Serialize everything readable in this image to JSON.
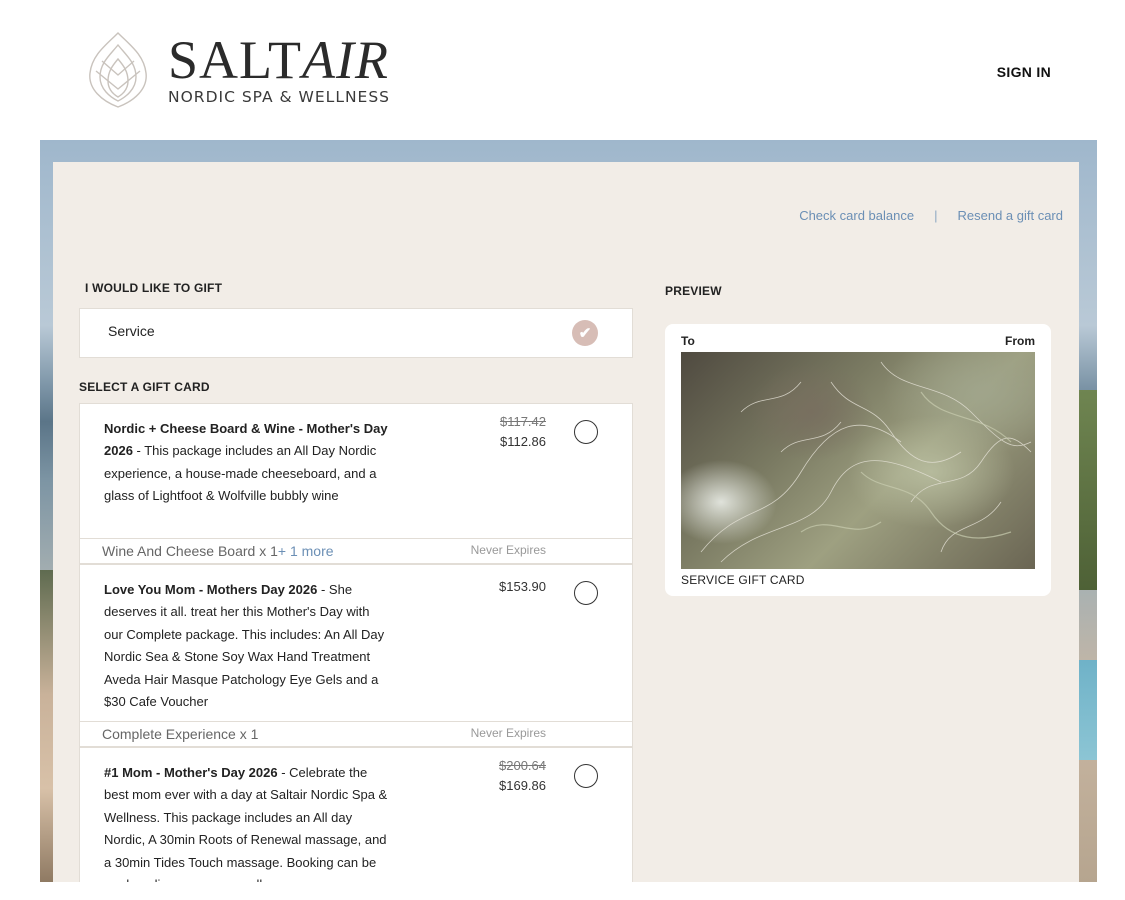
{
  "header": {
    "brand_name_a": "SALT",
    "brand_name_b": "AIR",
    "brand_tagline": "NORDIC SPA & WELLNESS",
    "sign_in": "SIGN IN"
  },
  "links": {
    "check_balance": "Check card balance",
    "separator": "|",
    "resend": "Resend a gift card"
  },
  "gift_type": {
    "label": "I WOULD LIKE TO GIFT",
    "selected": "Service",
    "check_icon": "check-icon"
  },
  "select_label": "SELECT A GIFT CARD",
  "cards": [
    {
      "title": "Nordic + Cheese Board & Wine - Mother's Day 2026",
      "description": " - This package includes an All Day Nordic experience, a house-made cheeseboard, and a glass of Lightfoot & Wolfville bubbly wine",
      "original_price": "$117.42",
      "price": "$112.86",
      "includes": "Wine And Cheese Board x 1",
      "more": "+ 1 more",
      "expiry": "Never Expires"
    },
    {
      "title": "Love You Mom - Mothers Day 2026",
      "description": " - She deserves it all. treat her this Mother's Day with our Complete package. This includes: An All Day Nordic Sea & Stone Soy Wax Hand Treatment Aveda Hair Masque Patchology Eye Gels and a $30 Cafe Voucher",
      "original_price": "",
      "price": "$153.90",
      "includes": "Complete Experience x 1",
      "more": "",
      "expiry": "Never Expires"
    },
    {
      "title": "#1 Mom - Mother's Day 2026",
      "description": " - Celebrate the best mom ever with a day at Saltair Nordic Spa & Wellness. This package includes an All day Nordic, A 30min Roots of Renewal massage, and a 30min Tides Touch massage. Booking can be made online or you can call",
      "original_price": "$200.64",
      "price": "$169.86",
      "includes": "",
      "more": "",
      "expiry": ""
    }
  ],
  "preview": {
    "label": "PREVIEW",
    "to": "To",
    "from": "From",
    "caption": "SERVICE GIFT CARD"
  }
}
